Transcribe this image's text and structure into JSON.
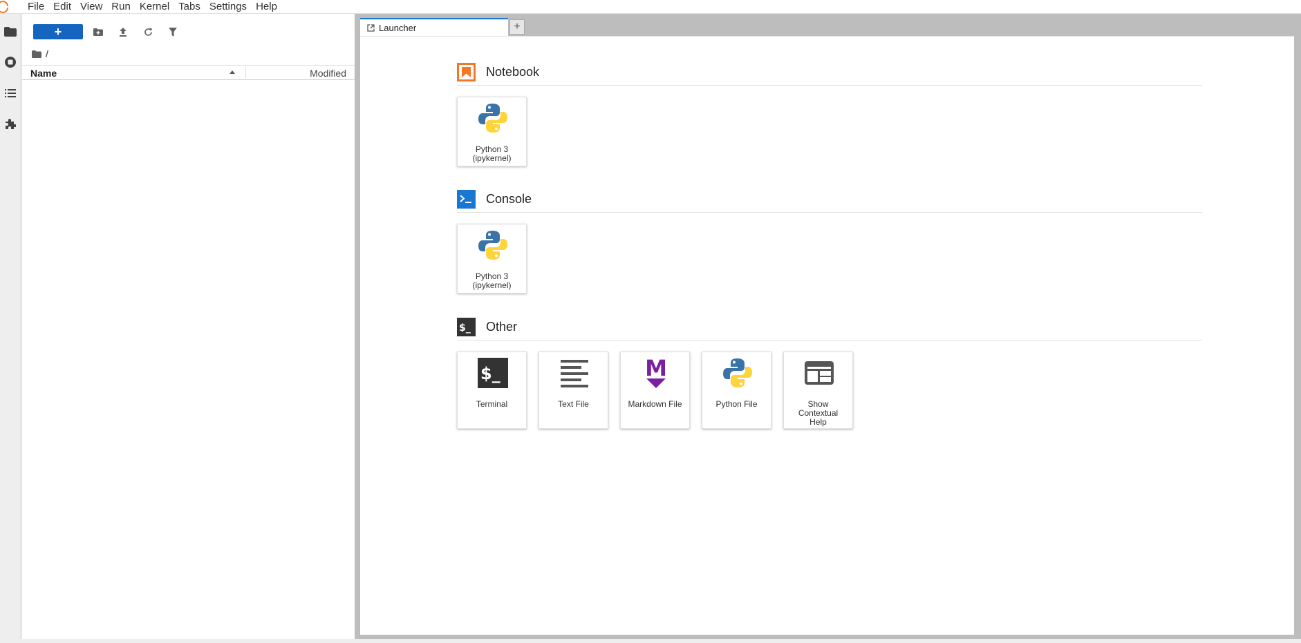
{
  "menubar": {
    "items": [
      "File",
      "Edit",
      "View",
      "Run",
      "Kernel",
      "Tabs",
      "Settings",
      "Help"
    ]
  },
  "file_browser": {
    "new_button_label": "+",
    "breadcrumb": "/",
    "columns": {
      "name": "Name",
      "modified": "Modified"
    }
  },
  "tabs": [
    {
      "label": "Launcher"
    }
  ],
  "add_tab_label": "+",
  "launcher": {
    "sections": [
      {
        "title": "Notebook",
        "items": [
          {
            "line1": "Python 3",
            "line2": "(ipykernel)"
          }
        ]
      },
      {
        "title": "Console",
        "items": [
          {
            "line1": "Python 3",
            "line2": "(ipykernel)"
          }
        ]
      },
      {
        "title": "Other",
        "items": [
          {
            "label": "Terminal"
          },
          {
            "label": "Text File"
          },
          {
            "label": "Markdown File"
          },
          {
            "label": "Python File"
          },
          {
            "line1": "Show",
            "line2": "Contextual",
            "line3": "Help"
          }
        ]
      }
    ]
  },
  "colors": {
    "brand_orange": "#f37726",
    "accent_blue": "#1565c0",
    "console_blue": "#1976d2",
    "markdown_purple": "#7b1fa2",
    "python_blue": "#3a73a8",
    "python_yellow": "#ffd43b"
  }
}
